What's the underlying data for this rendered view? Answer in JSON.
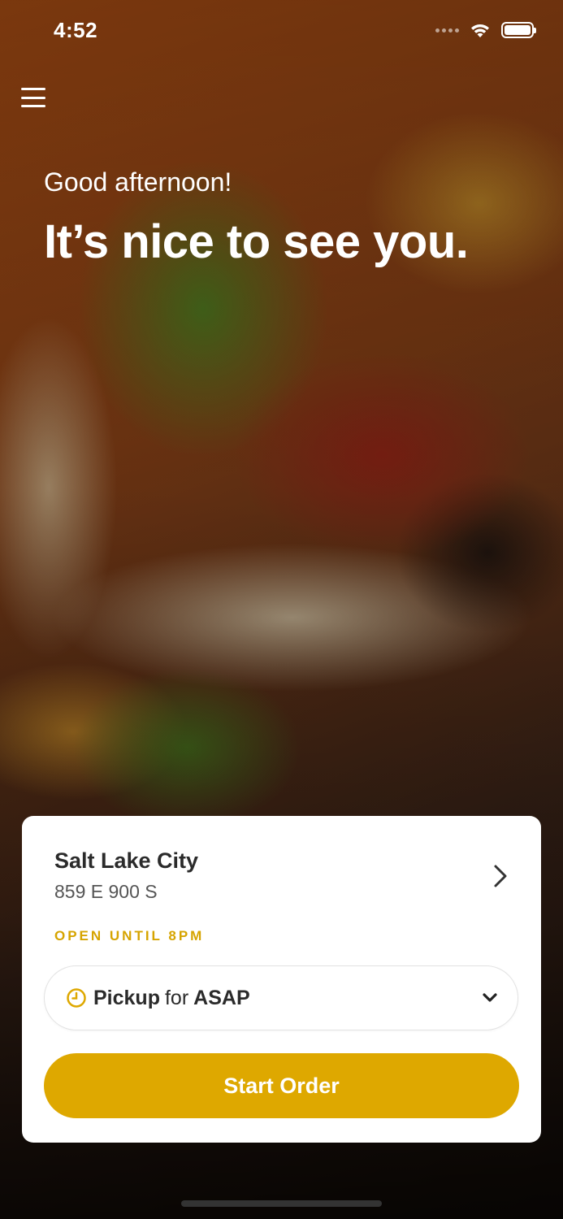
{
  "status_bar": {
    "time": "4:52"
  },
  "greeting": {
    "salutation": "Good afternoon!",
    "headline": "It’s nice to see you."
  },
  "store_card": {
    "store_name": "Salt Lake City",
    "address": "859 E 900 S",
    "hours_status": "OPEN UNTIL 8PM",
    "pickup": {
      "mode": "Pickup",
      "connector": "for",
      "time": "ASAP"
    },
    "cta_label": "Start Order"
  },
  "colors": {
    "accent": "#dea800",
    "hours_text": "#d6a400",
    "card_bg": "#ffffff"
  },
  "icons": [
    "menu-icon",
    "wifi-icon",
    "battery-icon",
    "chevron-right-icon",
    "clock-icon",
    "chevron-down-icon"
  ]
}
